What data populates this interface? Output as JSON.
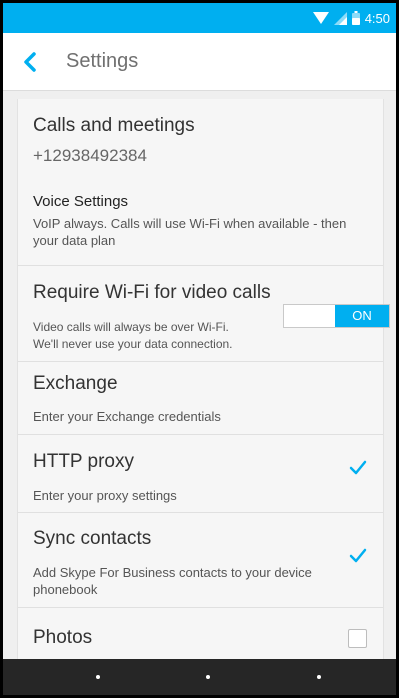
{
  "status_bar": {
    "time": "4:50",
    "icons": [
      "wifi-icon",
      "cell-signal-icon",
      "battery-icon"
    ],
    "background": "#00aff0"
  },
  "app_bar": {
    "title": "Settings",
    "back_icon": "chevron-left-icon",
    "accent": "#00aff0"
  },
  "settings": {
    "calls": {
      "title": "Calls and meetings",
      "phone": "+12938492384"
    },
    "voice": {
      "title": "Voice Settings",
      "description_line1": "VoIP always. Calls will use Wi-Fi when available - then",
      "description_line2": "your data plan"
    },
    "wifi_video": {
      "title": "Require Wi-Fi for video calls",
      "description_line1": "Video calls will always be over Wi-Fi.",
      "description_line2": "We'll never use your data connection.",
      "toggle_label": "ON",
      "toggle_on": true
    },
    "exchange": {
      "title": "Exchange",
      "description": "Enter your Exchange credentials"
    },
    "http_proxy": {
      "title": "HTTP proxy",
      "description": "Enter your proxy settings",
      "checked": true
    },
    "sync_contacts": {
      "title": "Sync contacts",
      "description_line1": "Add Skype For Business contacts to your device",
      "description_line2": "phonebook",
      "checked": true
    },
    "photos": {
      "title": "Photos",
      "checked": false
    }
  },
  "nav_bar": {
    "buttons": [
      "back",
      "home",
      "recents"
    ]
  }
}
